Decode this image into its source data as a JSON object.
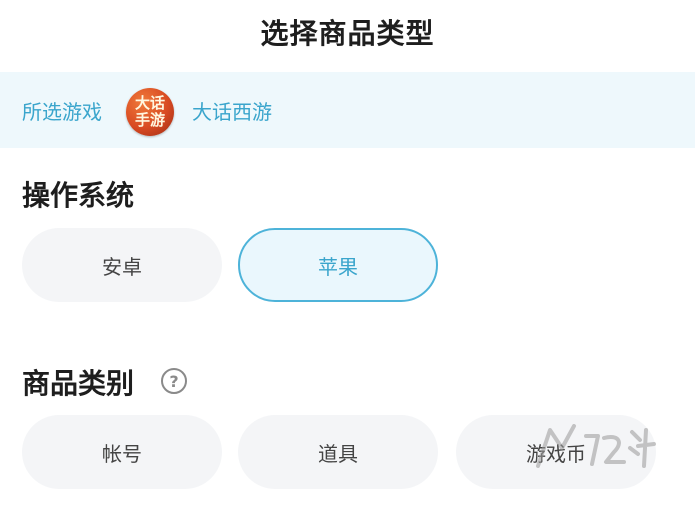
{
  "header": {
    "title": "选择商品类型"
  },
  "game": {
    "label": "所选游戏",
    "logo_text_line1": "大话",
    "logo_text_line2": "手游",
    "name": "大话西游"
  },
  "os_section": {
    "title": "操作系统",
    "options": [
      {
        "label": "安卓",
        "selected": false
      },
      {
        "label": "苹果",
        "selected": true
      }
    ]
  },
  "category_section": {
    "title": "商品类别",
    "help_icon": "question-icon",
    "options": [
      {
        "label": "帐号"
      },
      {
        "label": "道具"
      },
      {
        "label": "游戏币"
      }
    ]
  },
  "colors": {
    "accent": "#3aa5cc",
    "selected_border": "#4db3d9",
    "bar_bg": "#eef8fc",
    "chip_bg": "#f4f5f7"
  }
}
